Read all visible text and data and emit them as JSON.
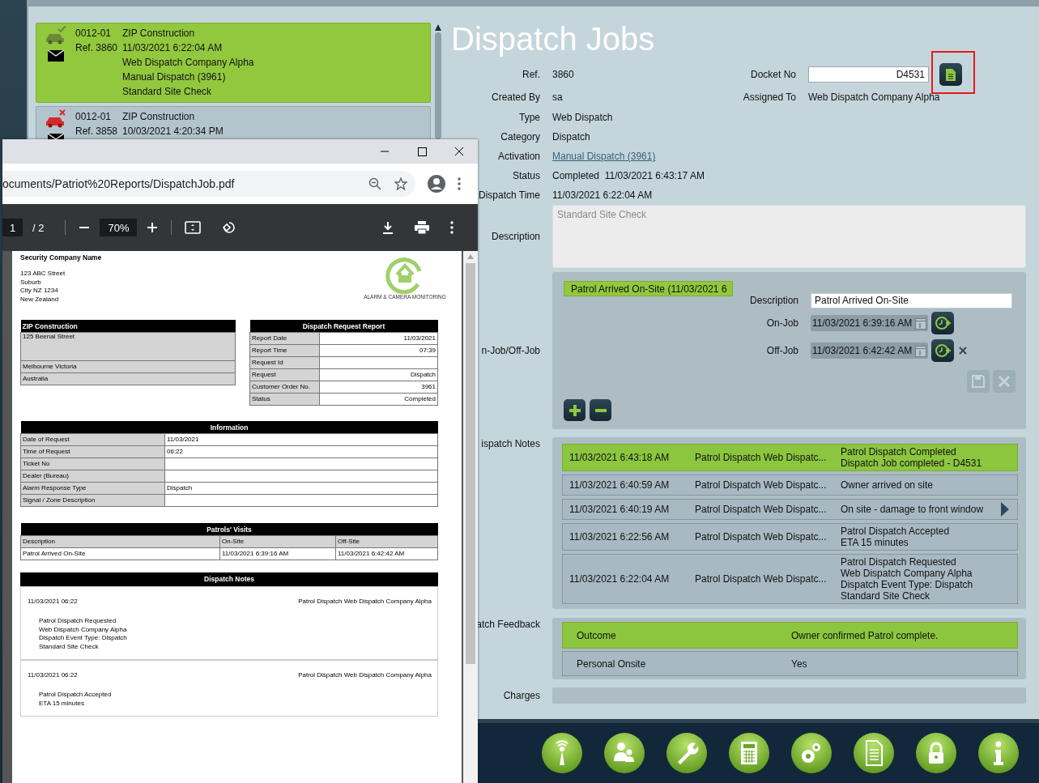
{
  "job_list": [
    {
      "selected": true,
      "kind": "ok",
      "code": "0012-01",
      "company": "ZIP Construction",
      "ref": "Ref. 3860",
      "datetime": "11/03/2021 6:22:04 AM",
      "lines": [
        "Web Dispatch Company Alpha",
        "Manual Dispatch (3961)",
        "Standard Site Check"
      ]
    },
    {
      "selected": false,
      "kind": "failed",
      "code": "0012-01",
      "company": "ZIP Construction",
      "ref": "Ref. 3858",
      "datetime": "10/03/2021 4:20:34 PM"
    }
  ],
  "dispatch_job": {
    "title": "Dispatch Jobs",
    "fields": [
      {
        "label": "Ref.",
        "value": "3860",
        "kind": "text"
      },
      {
        "label": "Created By",
        "value": "sa",
        "kind": "text"
      },
      {
        "label": "Type",
        "value": "Web Dispatch",
        "kind": "text"
      },
      {
        "label": "Category",
        "value": "Dispatch",
        "kind": "text"
      },
      {
        "label": "Activation",
        "value": "Manual Dispatch (3961)",
        "kind": "link"
      },
      {
        "label": "Status",
        "value": "Completed  11/03/2021 6:43:17 AM",
        "kind": "text"
      },
      {
        "label": "Dispatch Time",
        "value": "11/03/2021 6:22:04 AM",
        "kind": "text"
      }
    ],
    "docket": {
      "label": "Docket No",
      "value": "D4531"
    },
    "assigned_to": {
      "label": "Assigned To",
      "value": "Web Dispatch Company Alpha"
    },
    "description": {
      "label": "Description",
      "placeholder": "Standard Site Check"
    },
    "visits": {
      "label": "n-Job/Off-Job",
      "tabs": [
        {
          "label": "Patrol Arrived On-Site (11/03/2021 6",
          "selected": true
        }
      ],
      "description": {
        "label": "Description",
        "value": "Patrol Arrived On-Site"
      },
      "times": [
        {
          "label": "On-Job",
          "value": "11/03/2021 6:39:16 AM",
          "clearable": false
        },
        {
          "label": "Off-Job",
          "value": "11/03/2021 6:42:42 AM",
          "clearable": true
        }
      ],
      "actions": [
        {
          "kind": "save",
          "disabled": true
        },
        {
          "kind": "cancel",
          "disabled": true
        }
      ]
    },
    "notes": {
      "label": "ispatch Notes",
      "rows": [
        {
          "time": "11/03/2021 6:43:18 AM",
          "author": "Patrol Dispatch Web Dispatc...",
          "lines": [
            "Patrol Dispatch Completed",
            "Dispatch Job completed - D4531"
          ],
          "selected": true,
          "arrow": false
        },
        {
          "time": "11/03/2021 6:40:59 AM",
          "author": "Patrol Dispatch Web Dispatc...",
          "lines": [
            "Owner arrived on site"
          ],
          "selected": false,
          "arrow": false
        },
        {
          "time": "11/03/2021 6:40:19 AM",
          "author": "Patrol Dispatch Web Dispatc...",
          "lines": [
            "On site - damage to front window"
          ],
          "selected": false,
          "arrow": true
        },
        {
          "time": "11/03/2021 6:22:56 AM",
          "author": "Patrol Dispatch Web Dispatc...",
          "lines": [
            "Patrol Dispatch Accepted",
            "ETA 15 minutes"
          ],
          "selected": false,
          "arrow": false
        },
        {
          "time": "11/03/2021 6:22:04 AM",
          "author": "Patrol Dispatch Web Dispatc...",
          "lines": [
            "Patrol Dispatch Requested",
            "Web Dispatch Company Alpha",
            "Dispatch Event Type: Dispatch",
            "Standard Site Check"
          ],
          "selected": false,
          "arrow": false
        }
      ]
    },
    "feedback": {
      "label": "atch Feedback",
      "rows": [
        {
          "name": "Outcome",
          "value": "Owner confirmed Patrol complete.",
          "selected": true
        },
        {
          "name": "Personal Onsite",
          "value": "Yes",
          "selected": false
        }
      ]
    },
    "charges": {
      "label": "Charges"
    }
  },
  "pdf_viewer": {
    "url": "ocuments/Patriot%20Reports/DispatchJob.pdf",
    "page": "1",
    "page_total": "/ 2",
    "zoom": "70%",
    "document": {
      "company": "Security Company Name",
      "address": [
        "123 ABC Street",
        "Suburb",
        "City NZ 1234",
        "New Zealand"
      ],
      "logo_caption": "ALARM & CAMERA MONITORING",
      "site": {
        "title": "ZIP Construction",
        "lines": [
          "125 Beenal Street",
          "Melbourne Victoria",
          "Australia"
        ]
      },
      "request": {
        "title": "Dispatch Request Report",
        "rows": [
          {
            "label": "Report Date",
            "value": "11/03/2021"
          },
          {
            "label": "Report Time",
            "value": "07:39"
          },
          {
            "label": "Request Id"
          },
          {
            "label": "Request",
            "value": "Dispatch"
          },
          {
            "label": "Customer Order No.",
            "value": "3961"
          },
          {
            "label": "Status",
            "value": "Completed"
          }
        ]
      },
      "information": {
        "title": "Information",
        "rows": [
          {
            "label": "Date of Request",
            "value": "11/03/2021"
          },
          {
            "label": "Time of Request",
            "value": "06:22"
          },
          {
            "label": "Ticket No"
          },
          {
            "label": "Dealer (Bureau)"
          },
          {
            "label": "Alarm Response Type",
            "value": "Dispatch"
          },
          {
            "label": "Signal / Zone Description"
          }
        ]
      },
      "visits": {
        "title": "Patrols' Visits",
        "columns": [
          "Description",
          "On-Site",
          "Off-Site"
        ],
        "rows": [
          [
            "Patrol Arrived On-Site",
            "11/03/2021 6:39:16 AM",
            "11/03/2021 6:42:42 AM"
          ]
        ]
      },
      "notes": {
        "title": "Dispatch Notes",
        "entries": [
          {
            "time": "11/03/2021 06:22",
            "author": "Patrol Dispatch Web Dispatch Company Alpha",
            "lines": [
              "Patrol Dispatch Requested",
              "Web Dispatch Company Alpha",
              "Dispatch Event Type: Dispatch",
              "Standard Site Check"
            ]
          },
          {
            "time": "11/03/2021 06:22",
            "author": "Patrol Dispatch Web Dispatch Company Alpha",
            "lines": [
              "Patrol Dispatch Accepted",
              "ETA 15 minutes"
            ]
          }
        ]
      }
    }
  }
}
